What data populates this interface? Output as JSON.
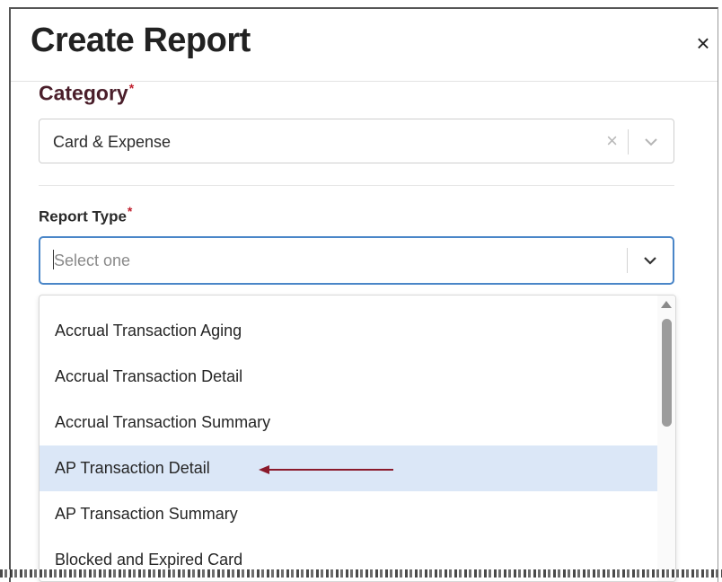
{
  "modal": {
    "title": "Create Report",
    "close_label": "×"
  },
  "category": {
    "label": "Category",
    "required_mark": "*",
    "value": "Card & Expense",
    "clear_label": "×"
  },
  "report_type": {
    "label": "Report Type",
    "required_mark": "*",
    "placeholder": "Select one",
    "options": [
      "Accrual Transaction Aging",
      "Accrual Transaction Detail",
      "Accrual Transaction Summary",
      "AP Transaction Detail",
      "AP Transaction Summary",
      "Blocked and Expired Card"
    ],
    "highlighted_index": 3
  },
  "colors": {
    "focus_border": "#4a86c8",
    "highlight_bg": "#dbe7f7",
    "annotation_arrow": "#8b1a2b",
    "required": "#c0202e"
  },
  "icons": {
    "close": "close-icon",
    "clear": "clear-icon",
    "chevron": "chevron-down-icon",
    "scroll_up": "scroll-up-arrow-icon",
    "annotation": "annotation-arrow-icon"
  }
}
